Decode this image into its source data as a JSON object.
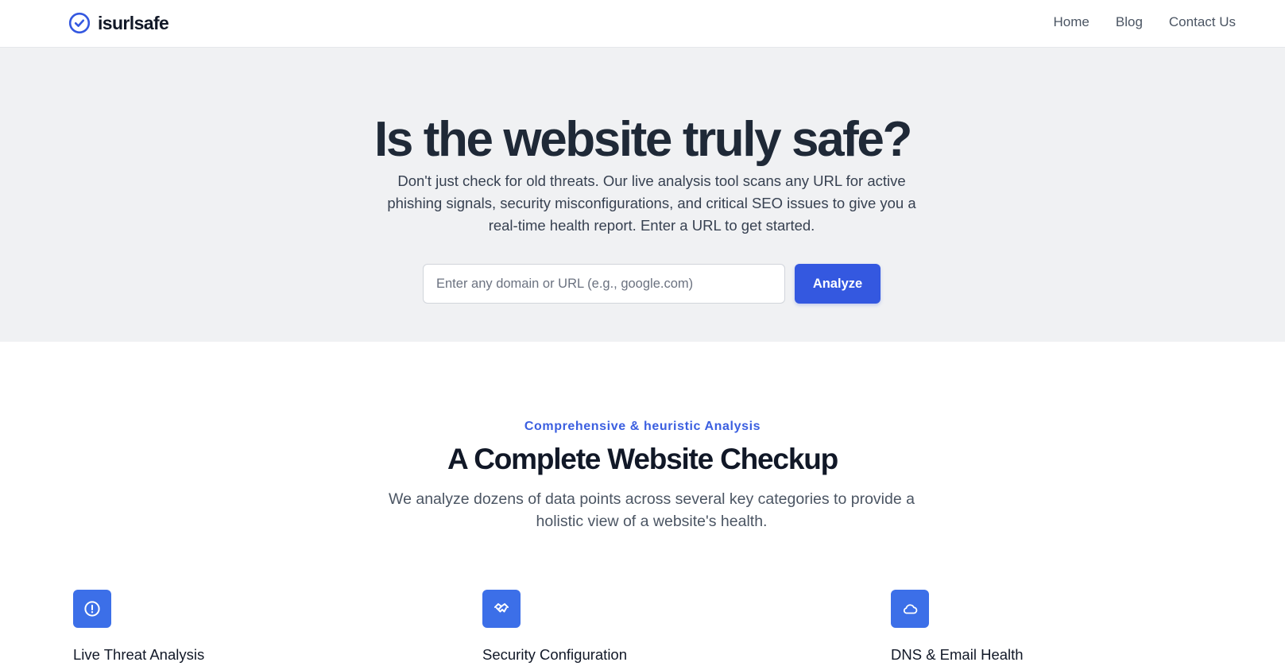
{
  "brand": {
    "name": "isurlsafe",
    "logo_icon": "check-circle-icon",
    "accent": "#3458e0"
  },
  "nav": {
    "items": [
      {
        "label": "Home"
      },
      {
        "label": "Blog"
      },
      {
        "label": "Contact Us"
      }
    ]
  },
  "hero": {
    "title": "Is the website truly safe?",
    "description": "Don't just check for old threats. Our live analysis tool scans any URL for active phishing signals, security misconfigurations, and critical SEO issues to give you a real-time health report. Enter a URL to get started.",
    "search": {
      "placeholder": "Enter any domain or URL (e.g., google.com)",
      "value": ""
    },
    "button_label": "Analyze",
    "background": "#f0f1f3"
  },
  "features": {
    "eyebrow": "Comprehensive & heuristic Analysis",
    "title": "A Complete Website Checkup",
    "description": "We analyze dozens of data points across several key categories to provide a holistic view of a website's health.",
    "items": [
      {
        "title": "Live Threat Analysis",
        "icon": "alert-circle-icon"
      },
      {
        "title": "Security Configuration",
        "icon": "handshake-icon"
      },
      {
        "title": "DNS & Email Health",
        "icon": "cloud-icon"
      }
    ],
    "icon_background": "#3c6fe8"
  }
}
